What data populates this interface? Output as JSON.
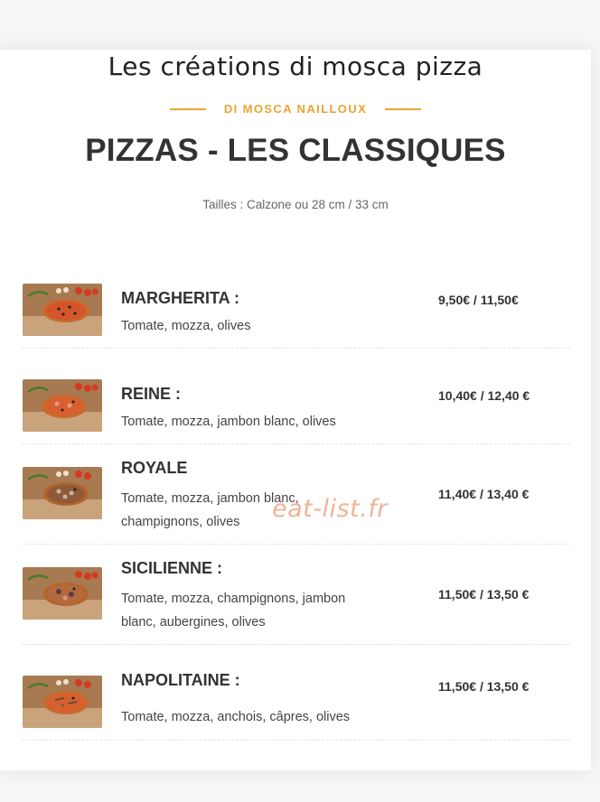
{
  "header": {
    "script_title": "Les créations di mosca pizza",
    "subtitle": "DI MOSCA NAILLOUX",
    "title": "PIZZAS - LES CLASSIQUES",
    "sizes": "Tailles : Calzone ou 28 cm / 33 cm"
  },
  "items": [
    {
      "name": "MARGHERITA :",
      "desc": "Tomate, mozza, olives",
      "price": "9,50€ / 11,50€",
      "image": "pizza-margherita-image"
    },
    {
      "name": "REINE :",
      "desc": "Tomate, mozza, jambon blanc, olives",
      "price": "10,40€ / 12,40 €",
      "image": "pizza-reine-image"
    },
    {
      "name": "ROYALE",
      "desc": "Tomate, mozza, jambon blanc, champignons, olives",
      "price": "11,40€ / 13,40 €",
      "image": "pizza-royale-image"
    },
    {
      "name": "SICILIENNE :",
      "desc": "Tomate, mozza, champignons, jambon blanc, aubergines, olives",
      "price": "11,50€ / 13,50 €",
      "image": "pizza-sicilienne-image"
    },
    {
      "name": "NAPOLITAINE :",
      "desc": "Tomate, mozza, anchois, câpres, olives",
      "price": "11,50€ / 13,50 €",
      "image": "pizza-napolitaine-image"
    }
  ],
  "watermark": "eat-list.fr",
  "colors": {
    "accent": "#e8a533",
    "text": "#333333",
    "watermark": "#f0a585"
  }
}
